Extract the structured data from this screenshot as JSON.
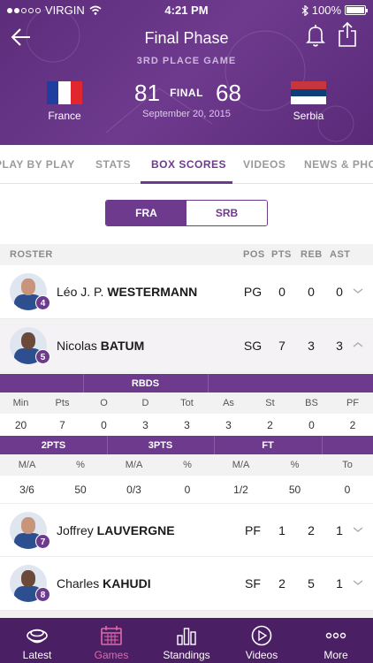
{
  "status_bar": {
    "carrier": "VIRGIN",
    "time": "4:21 PM",
    "battery": "100%"
  },
  "header": {
    "title": "Final Phase",
    "subtitle": "3RD PLACE GAME",
    "home_team": "France",
    "away_team": "Serbia",
    "home_score": "81",
    "away_score": "68",
    "result": "FINAL",
    "date": "September 20, 2015"
  },
  "tabs": [
    "PLAY BY PLAY",
    "STATS",
    "BOX SCORES",
    "VIDEOS",
    "NEWS & PHO"
  ],
  "active_tab": "BOX SCORES",
  "segment": {
    "team_a": "FRA",
    "team_b": "SRB",
    "selected": "FRA"
  },
  "roster_header": {
    "roster": "ROSTER",
    "pos": "POS",
    "pts": "PTS",
    "reb": "REB",
    "ast": "AST"
  },
  "players": [
    {
      "first": "Léo J. P.",
      "last": "WESTERMANN",
      "number": "4",
      "pos": "PG",
      "pts": "0",
      "reb": "0",
      "ast": "0",
      "expanded": false
    },
    {
      "first": "Nicolas",
      "last": "BATUM",
      "number": "5",
      "pos": "SG",
      "pts": "7",
      "reb": "3",
      "ast": "3",
      "expanded": true
    },
    {
      "first": "Joffrey",
      "last": "LAUVERGNE",
      "number": "7",
      "pos": "PF",
      "pts": "1",
      "reb": "2",
      "ast": "1",
      "expanded": false
    },
    {
      "first": "Charles",
      "last": "KAHUDI",
      "number": "8",
      "pos": "SF",
      "pts": "2",
      "reb": "5",
      "ast": "1",
      "expanded": false
    }
  ],
  "expanded_stats": {
    "rbds_label": "RBDS",
    "row1_labels": [
      "Min",
      "Pts",
      "O",
      "D",
      "Tot",
      "As",
      "St",
      "BS",
      "PF"
    ],
    "row1_values": [
      "20",
      "7",
      "0",
      "3",
      "3",
      "3",
      "2",
      "0",
      "2"
    ],
    "groups": [
      "2PTS",
      "3PTS",
      "FT"
    ],
    "row2_labels": [
      "M/A",
      "%",
      "M/A",
      "%",
      "M/A",
      "%",
      "To"
    ],
    "row2_values": [
      "3/6",
      "50",
      "0/3",
      "0",
      "1/2",
      "50",
      "0"
    ]
  },
  "bottom_nav": [
    {
      "label": "Latest",
      "icon": "latest-icon"
    },
    {
      "label": "Games",
      "icon": "calendar-icon"
    },
    {
      "label": "Standings",
      "icon": "standings-icon"
    },
    {
      "label": "Videos",
      "icon": "play-icon"
    },
    {
      "label": "More",
      "icon": "more-icon"
    }
  ],
  "active_nav": "Games",
  "colors": {
    "primary": "#6e3a8e",
    "nav_bg": "#4a1f63",
    "active_nav": "#e06aa8"
  }
}
